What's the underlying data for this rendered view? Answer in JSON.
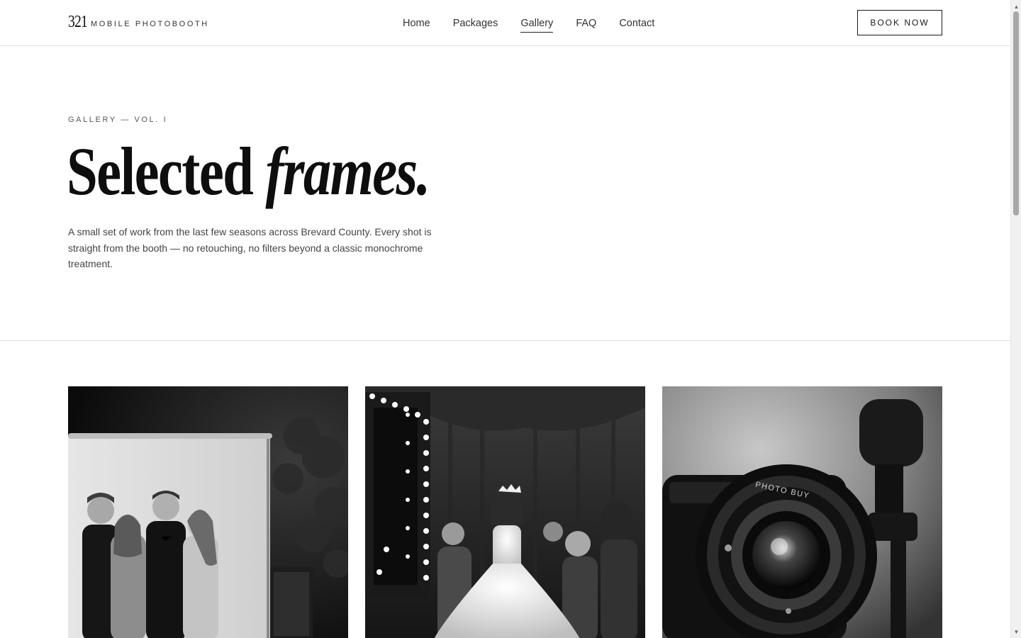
{
  "header": {
    "logo_mark": "321",
    "logo_text": "MOBILE PHOTOBOOTH",
    "nav": [
      {
        "label": "Home",
        "active": false
      },
      {
        "label": "Packages",
        "active": false
      },
      {
        "label": "Gallery",
        "active": true
      },
      {
        "label": "FAQ",
        "active": false
      },
      {
        "label": "Contact",
        "active": false
      }
    ],
    "cta_label": "BOOK NOW"
  },
  "hero": {
    "eyebrow": "GALLERY — VOL. I",
    "headline_roman": "Selected ",
    "headline_italic": "frames.",
    "lede": "A small set of work from the last few seasons across Brevard County. Every shot is straight from the booth — no retouching, no filters beyond a classic monochrome treatment."
  },
  "gallery": {
    "photos": [
      {
        "subject": "four guests in formal wear laughing in front of a white backdrop"
      },
      {
        "subject": "quinceañera in tiara and gown with friends beside a lit mirror booth"
      },
      {
        "subject": "close-up of a photo booth camera lens",
        "lens_text": "PHOTO BUY"
      }
    ]
  },
  "colors": {
    "text": "#1a1a1a",
    "muted": "#555555",
    "divider": "#e2e2e2",
    "background": "#ffffff"
  }
}
